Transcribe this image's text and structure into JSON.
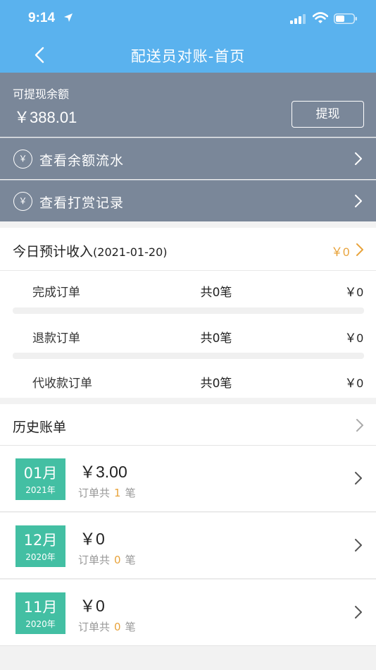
{
  "status_bar": {
    "time": "9:14"
  },
  "nav": {
    "title": "配送员对账-首页"
  },
  "balance": {
    "label": "可提现余额",
    "amount": "￥388.01",
    "withdraw_label": "提现"
  },
  "links": [
    {
      "icon": "￥",
      "label": "查看余额流水"
    },
    {
      "icon": "￥",
      "label": "查看打赏记录"
    }
  ],
  "today": {
    "title": "今日预计收入",
    "date": "(2021-01-20)",
    "total": "￥0",
    "rows": [
      {
        "name": "完成订单",
        "count": "共0笔",
        "amount": "￥0"
      },
      {
        "name": "退款订单",
        "count": "共0笔",
        "amount": "￥0"
      },
      {
        "name": "代收款订单",
        "count": "共0笔",
        "amount": "￥0"
      }
    ]
  },
  "history": {
    "title": "历史账单",
    "orders_prefix": "订单共",
    "orders_suffix": "笔",
    "items": [
      {
        "month": "01月",
        "year": "2021年",
        "amount": "￥3.00",
        "count": "1"
      },
      {
        "month": "12月",
        "year": "2020年",
        "amount": "￥0",
        "count": "0"
      },
      {
        "month": "11月",
        "year": "2020年",
        "amount": "￥0",
        "count": "0"
      }
    ]
  },
  "colors": {
    "header_blue": "#5ab2ee",
    "balance_slate": "#7a8799",
    "accent_orange": "#e8a33b",
    "badge_green": "#43bfa3"
  }
}
